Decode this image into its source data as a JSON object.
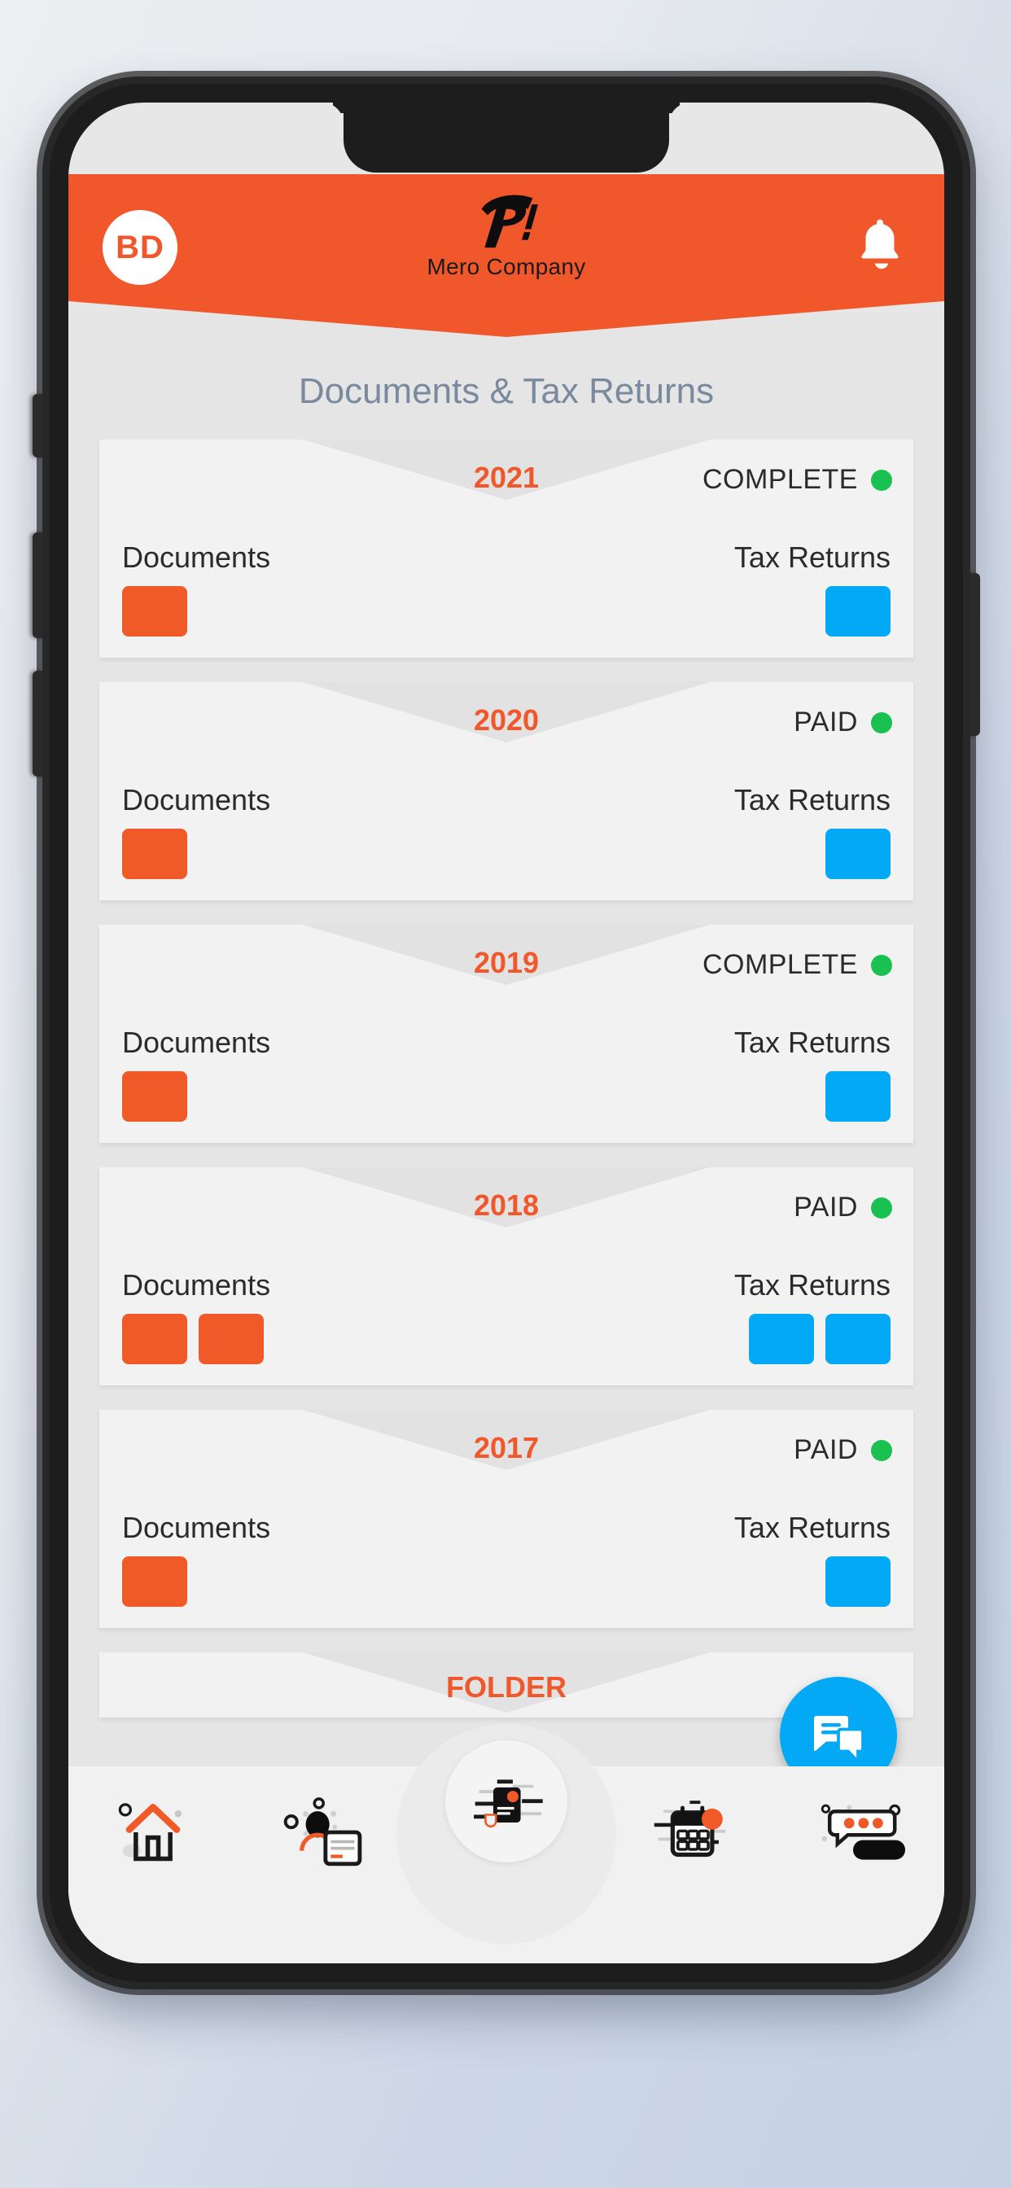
{
  "header": {
    "avatar_initials": "BD",
    "brand_name": "Mero Company",
    "logo_icon": "p-swoosh-logo",
    "bell_icon": "notification-bell-icon",
    "bg_color": "#f0572a"
  },
  "main": {
    "page_title": "Documents & Tax Returns",
    "documents_label": "Documents",
    "tax_returns_label": "Tax Returns",
    "doc_tile_color": "#f05a28",
    "tax_tile_color": "#03a9f4",
    "status_dot_color": "#18c150",
    "year_color": "#f0572a",
    "cards": [
      {
        "year": "2021",
        "status": "COMPLETE",
        "documents_count": 1,
        "tax_returns_count": 1
      },
      {
        "year": "2020",
        "status": "PAID",
        "documents_count": 1,
        "tax_returns_count": 1
      },
      {
        "year": "2019",
        "status": "COMPLETE",
        "documents_count": 1,
        "tax_returns_count": 1
      },
      {
        "year": "2018",
        "status": "PAID",
        "documents_count": 2,
        "tax_returns_count": 2
      },
      {
        "year": "2017",
        "status": "PAID",
        "documents_count": 1,
        "tax_returns_count": 1
      }
    ],
    "folder_label": "FOLDER"
  },
  "chat_fab": {
    "icon": "chat-bubbles-icon",
    "color": "#03a9f4"
  },
  "bottom_nav": {
    "items": [
      {
        "icon": "home-icon"
      },
      {
        "icon": "user-document-icon"
      },
      {
        "icon": "document-upload-icon"
      },
      {
        "icon": "calendar-icon"
      },
      {
        "icon": "chat-message-icon"
      }
    ]
  }
}
